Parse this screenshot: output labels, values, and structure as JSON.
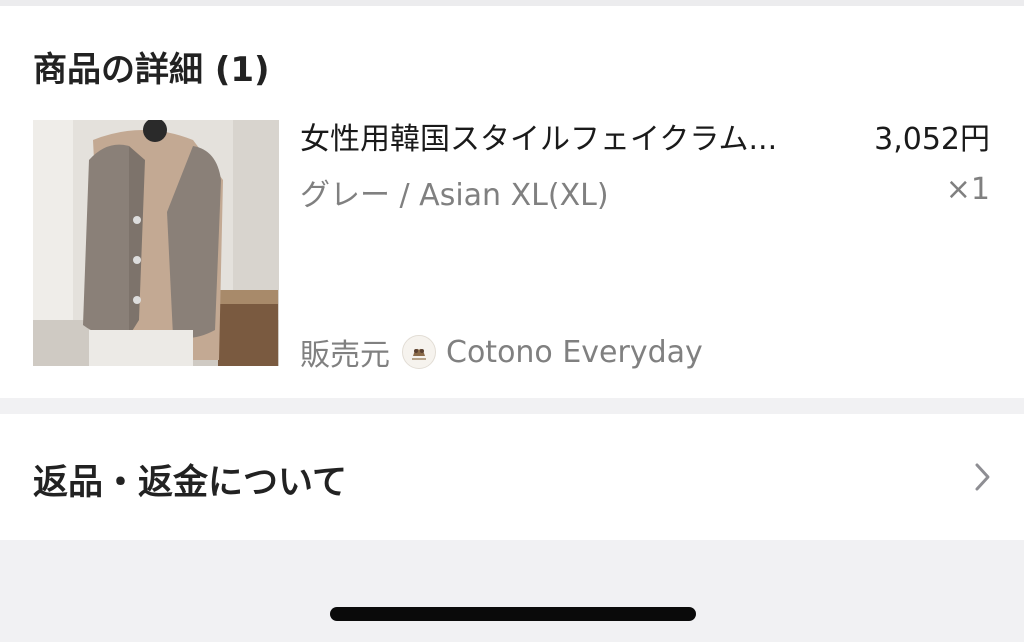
{
  "order_details": {
    "section_title": "商品の詳細 (1)",
    "item": {
      "name": "女性用韓国スタイルフェイクラム...",
      "price": "3,052円",
      "variant": "グレー / Asian XL(XL)",
      "quantity": "×1",
      "image_icon": "product-photo-fleece-vest",
      "seller_label": "販売元",
      "seller_name": "Cotono Everyday",
      "seller_avatar_icon": "store-logo-icon"
    }
  },
  "returns": {
    "label": "返品・返金について",
    "icon": "chevron-right-icon"
  }
}
